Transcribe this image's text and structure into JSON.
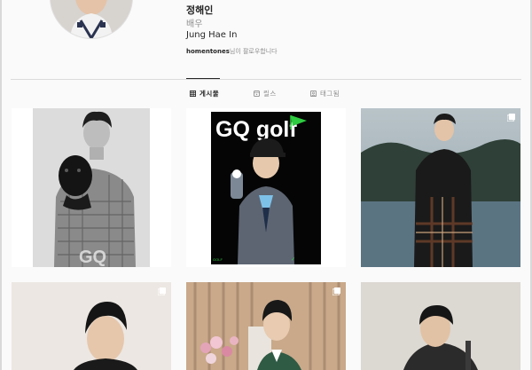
{
  "profile": {
    "username": "정해인",
    "category": "배우",
    "full_name": "Jung Hae In",
    "followed_by_user": "homentones",
    "followed_by_suffix": "님이 팔로우합니다"
  },
  "tabs": [
    {
      "label": "게시물",
      "icon": "grid-icon",
      "active": true
    },
    {
      "label": "릴스",
      "icon": "reels-icon",
      "active": false
    },
    {
      "label": "태그됨",
      "icon": "tagged-icon",
      "active": false
    }
  ],
  "posts": [
    {
      "id": "post-1",
      "description": "bw-portrait-with-panther",
      "logo_text": "GQ",
      "multi": false
    },
    {
      "id": "post-2",
      "description": "gq-golf-magazine-cover",
      "logo_text": "GQ golf",
      "multi": false
    },
    {
      "id": "post-3",
      "description": "lake-portrait-plaid-coat",
      "multi": true
    },
    {
      "id": "post-4",
      "description": "studio-portrait",
      "multi": true
    },
    {
      "id": "post-5",
      "description": "flowers-and-curtains",
      "multi": true
    },
    {
      "id": "post-6",
      "description": "suit-portrait",
      "multi": false
    }
  ],
  "colors": {
    "accent_text": "#262626",
    "muted_text": "#8e8e8e",
    "background": "#fafafa"
  }
}
